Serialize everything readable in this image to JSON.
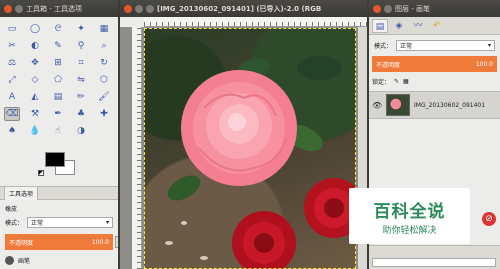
{
  "toolbox": {
    "title": "工具箱 - 工具选项",
    "tool_options_tab": "工具选项",
    "tool_name": "橡皮",
    "mode_label": "模式：",
    "mode_value": "正常",
    "opacity_label": "不透明度",
    "opacity_value": "100.0",
    "brush_label": "画笔"
  },
  "image_window": {
    "title": "[IMG_20130602_091401] (已导入)-2.0 (RGB"
  },
  "layers": {
    "title": "图层 - 画笔",
    "mode_label": "模式：",
    "mode_value": "正常",
    "opacity_label": "不透明度",
    "opacity_value": "100.0",
    "lock_label": "锁定：",
    "layer_name": "IMG_20130602_091401"
  },
  "watermark": {
    "title": "百科全说",
    "subtitle": "助你轻松解决"
  },
  "colors": {
    "accent": "#f07a3a",
    "foreground": "#000000",
    "background": "#ffffff"
  }
}
